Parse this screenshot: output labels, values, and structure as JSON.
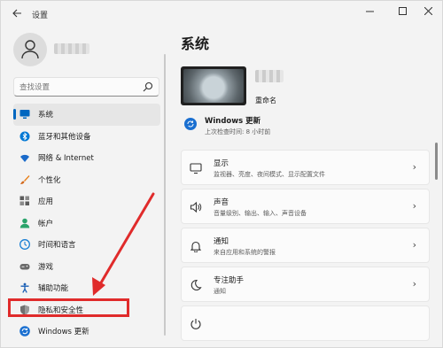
{
  "window": {
    "title": "设置",
    "back_icon": "arrow-left-icon",
    "controls": [
      "minimize-icon",
      "maximize-icon",
      "close-icon"
    ]
  },
  "sidebar": {
    "search_placeholder": "查找设置",
    "items": [
      {
        "label": "系统",
        "icon": "monitor-icon",
        "color": "#0067c0",
        "active": true
      },
      {
        "label": "蓝牙和其他设备",
        "icon": "bluetooth-icon",
        "color": "#0078d4"
      },
      {
        "label": "网络 & Internet",
        "icon": "wifi-icon",
        "color": "#1b6ac9"
      },
      {
        "label": "个性化",
        "icon": "brush-icon",
        "color": "#e8811c"
      },
      {
        "label": "应用",
        "icon": "apps-icon",
        "color": "#5c5c5c"
      },
      {
        "label": "帐户",
        "icon": "person-icon",
        "color": "#2aa46b"
      },
      {
        "label": "时间和语言",
        "icon": "globe-clock-icon",
        "color": "#1a7fd4"
      },
      {
        "label": "游戏",
        "icon": "gamepad-icon",
        "color": "#6b6b6b"
      },
      {
        "label": "辅助功能",
        "icon": "accessibility-icon",
        "color": "#1a5fb4"
      },
      {
        "label": "隐私和安全性",
        "icon": "shield-icon",
        "color": "#707070"
      },
      {
        "label": "Windows 更新",
        "icon": "sync-icon",
        "color": "#1a6fd0"
      }
    ],
    "highlight_color": "#e02b2b"
  },
  "main": {
    "title": "系统",
    "device": {
      "rename": "重命名"
    },
    "update": {
      "title": "Windows 更新",
      "subtitle": "上次检查时间: 8 小时前"
    },
    "cards": [
      {
        "title": "显示",
        "subtitle": "监视器、亮度、夜间模式、显示配置文件",
        "icon": "display-icon"
      },
      {
        "title": "声音",
        "subtitle": "音量级别、输出、输入、声音设备",
        "icon": "speaker-icon"
      },
      {
        "title": "通知",
        "subtitle": "来自应用和系统的警报",
        "icon": "bell-icon"
      },
      {
        "title": "专注助手",
        "subtitle": "通知",
        "icon": "moon-icon"
      },
      {
        "title": "",
        "subtitle": "",
        "icon": "power-icon"
      }
    ]
  },
  "colors": {
    "accent": "#0067c0",
    "window_bg": "#f3f3f3",
    "card_bg": "#fbfbfb"
  }
}
